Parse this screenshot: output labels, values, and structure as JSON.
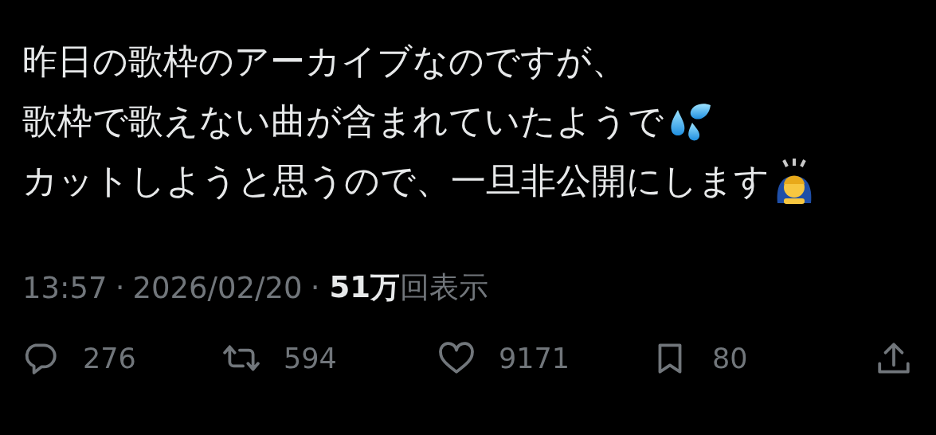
{
  "tweet": {
    "lines": [
      {
        "text": "昨日の歌枠のアーカイブなのですが、",
        "kind": "plain"
      },
      {
        "text": "歌枠で歌えない曲が含まれていたようで",
        "kind": "sweat"
      },
      {
        "text": "カットしようと思うので、一旦非公開にします",
        "kind": "bow"
      }
    ]
  },
  "meta": [
    {
      "kind": "plain",
      "text": "13:57"
    },
    {
      "kind": "plain",
      "text": "·"
    },
    {
      "kind": "plain",
      "text": "2026/02/20"
    },
    {
      "kind": "plain",
      "text": "·"
    },
    {
      "kind": "strong",
      "text": "51万"
    },
    {
      "kind": "plain",
      "text": "回表示"
    }
  ],
  "actions": [
    {
      "kind": "reply",
      "count": "276"
    },
    {
      "kind": "repost",
      "count": "594"
    },
    {
      "kind": "like",
      "count": "9171"
    },
    {
      "kind": "bookmark",
      "count": "80"
    },
    {
      "kind": "share"
    }
  ]
}
